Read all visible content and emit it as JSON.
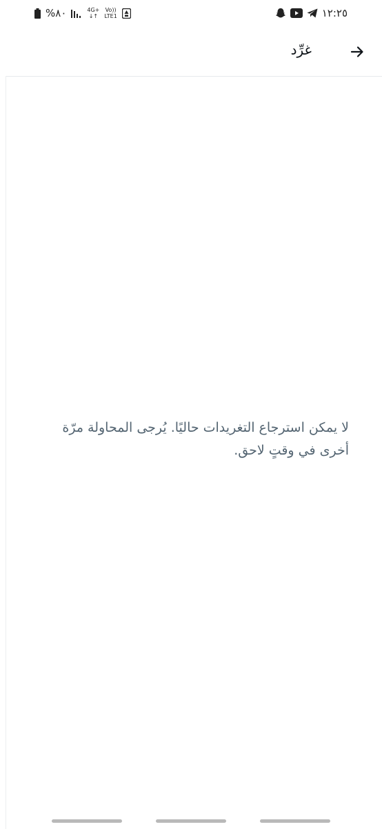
{
  "status_bar": {
    "time": "١٢:٢٥",
    "battery_text": "%٨٠",
    "network_top": "4G+",
    "network_bottom": "LTE1",
    "volte_top": "Vo))",
    "icons": [
      "telegram-icon",
      "youtube-icon",
      "snapchat-icon",
      "signal-icon",
      "battery-icon",
      "data-saver-icon"
    ]
  },
  "header": {
    "title": "غرِّد",
    "back_icon": "arrow-right-icon"
  },
  "main": {
    "message": "لا يمكن استرجاع التغريدات حاليًا. يُرجى المحاولة مرّة أخرى في وقتٍ لاحق."
  },
  "colors": {
    "text_primary": "#0f1419",
    "text_secondary": "#536471",
    "divider": "#e6e9ec",
    "nav_handle": "#b9b9b9"
  }
}
